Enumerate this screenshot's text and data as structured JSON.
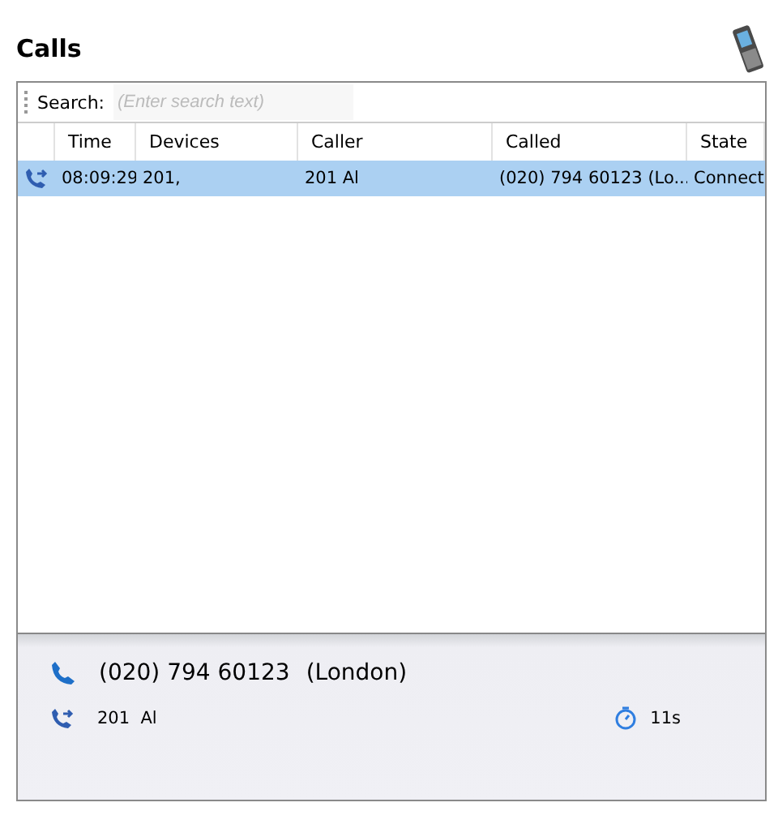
{
  "title": "Calls",
  "search": {
    "label": "Search:",
    "placeholder": "(Enter search text)"
  },
  "table": {
    "columns": [
      "Time",
      "Devices",
      "Caller",
      "Called",
      "State"
    ],
    "rows": [
      {
        "kind": "outgoing",
        "selected": true,
        "cells": [
          "08:09:29",
          "201,",
          "201 Al",
          "(020) 794 60123 (Lo...",
          "Connect"
        ]
      }
    ]
  },
  "detail": {
    "number": "(020) 794 60123",
    "place": "(London)",
    "party": "201  Al",
    "duration": "11s"
  }
}
